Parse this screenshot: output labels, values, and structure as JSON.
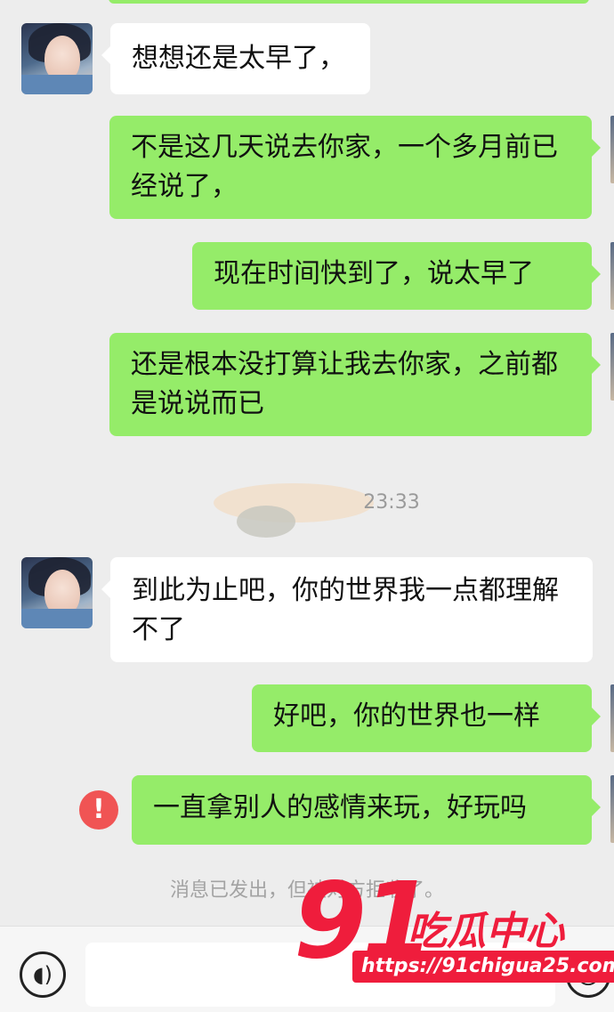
{
  "messages": [
    {
      "side": "in",
      "text": "想想还是太早了，"
    },
    {
      "side": "out",
      "text": "不是这几天说去你家，一个多月前已经说了，"
    },
    {
      "side": "out",
      "text": "现在时间快到了，说太早了"
    },
    {
      "side": "out",
      "text": "还是根本没打算让我去你家，之前都是说说而已"
    },
    {
      "side": "in",
      "text": "到此为止吧，你的世界我一点都理解不了"
    },
    {
      "side": "out",
      "text": "好吧，你的世界也一样"
    },
    {
      "side": "out",
      "text": "一直拿别人的感情来玩，好玩吗",
      "status": "failed"
    }
  ],
  "timestamp": "23:33",
  "system_note": "消息已发出，但被对方拒收了。",
  "input_bar": {
    "voice_icon": "voice-icon",
    "emoji_icon": "emoji-icon"
  },
  "watermark": {
    "number": "91",
    "brand": "吃瓜中心",
    "url": "https://91chigua25.com"
  },
  "colors": {
    "background": "#ededed",
    "outgoing_bubble": "#95ec69",
    "incoming_bubble": "#ffffff",
    "error": "#f05454",
    "watermark": "#ef1d3c"
  }
}
